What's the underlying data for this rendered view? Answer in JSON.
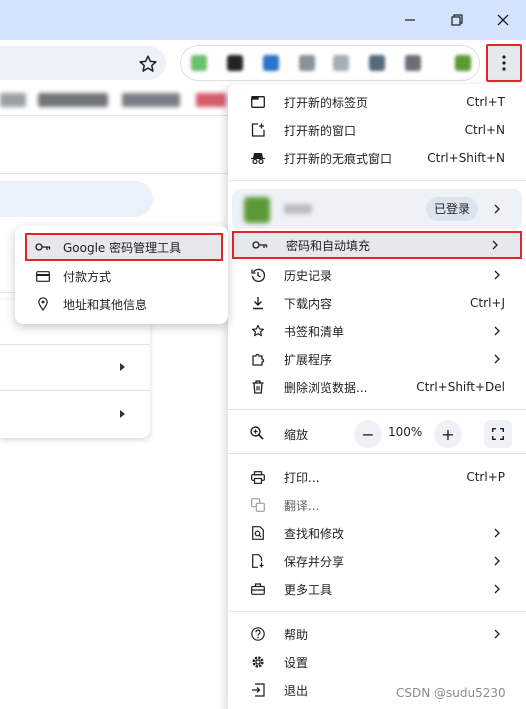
{
  "colors": {
    "titlebar": "#d3e3fd",
    "highlight_border": "#e0262b",
    "menu_bg": "#ffffff",
    "hover": "#e5e8ed"
  },
  "window": {
    "controls": [
      "minimize-icon",
      "restore-icon",
      "close-icon"
    ]
  },
  "menu": {
    "items_top": [
      {
        "icon": "new-tab-icon",
        "label": "打开新的标签页",
        "shortcut": "Ctrl+T"
      },
      {
        "icon": "new-window-icon",
        "label": "打开新的窗口",
        "shortcut": "Ctrl+N"
      },
      {
        "icon": "incognito-icon",
        "label": "打开新的无痕式窗口",
        "shortcut": "Ctrl+Shift+N"
      }
    ],
    "profile": {
      "signed_in": "已登录"
    },
    "items_mid": [
      {
        "icon": "key-icon",
        "label": "密码和自动填充",
        "shortcut": "",
        "submenu": true
      },
      {
        "icon": "history-icon",
        "label": "历史记录",
        "shortcut": "",
        "submenu": true
      },
      {
        "icon": "download-icon",
        "label": "下载内容",
        "shortcut": "Ctrl+J",
        "submenu": false
      },
      {
        "icon": "star-icon",
        "label": "书签和清单",
        "shortcut": "",
        "submenu": true
      },
      {
        "icon": "extension-icon",
        "label": "扩展程序",
        "shortcut": "",
        "submenu": true
      },
      {
        "icon": "trash-icon",
        "label": "删除浏览数据...",
        "shortcut": "Ctrl+Shift+Del",
        "submenu": false
      }
    ],
    "zoom": {
      "label": "缩放",
      "minus": "−",
      "value": "100%",
      "plus": "+"
    },
    "items_tools": [
      {
        "icon": "print-icon",
        "label": "打印...",
        "shortcut": "Ctrl+P",
        "submenu": false
      },
      {
        "icon": "translate-icon",
        "label": "翻译...",
        "shortcut": "",
        "submenu": false
      },
      {
        "icon": "find-icon",
        "label": "查找和修改",
        "shortcut": "",
        "submenu": true
      },
      {
        "icon": "save-share-icon",
        "label": "保存并分享",
        "shortcut": "",
        "submenu": true
      },
      {
        "icon": "toolbox-icon",
        "label": "更多工具",
        "shortcut": "",
        "submenu": true
      }
    ],
    "items_bottom": [
      {
        "icon": "help-icon",
        "label": "帮助",
        "submenu": true
      },
      {
        "icon": "settings-icon",
        "label": "设置",
        "submenu": false
      },
      {
        "icon": "exit-icon",
        "label": "退出",
        "submenu": false
      }
    ]
  },
  "submenu": {
    "items": [
      {
        "icon": "key-icon",
        "label": "Google 密码管理工具"
      },
      {
        "icon": "credit-card-icon",
        "label": "付款方式"
      },
      {
        "icon": "location-pin-icon",
        "label": "地址和其他信息"
      }
    ]
  },
  "watermark": "CSDN @sudu5230"
}
